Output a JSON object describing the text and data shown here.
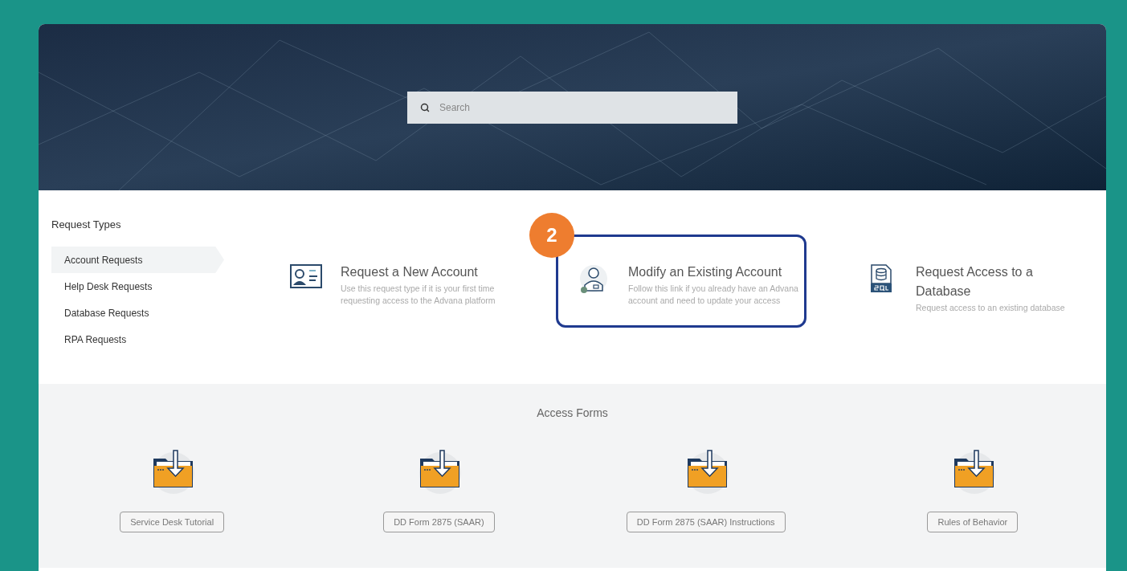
{
  "search": {
    "placeholder": "Search"
  },
  "request_types": {
    "title": "Request Types",
    "items": [
      {
        "label": "Account Requests",
        "selected": true
      },
      {
        "label": "Help Desk Requests",
        "selected": false
      },
      {
        "label": "Database Requests",
        "selected": false
      },
      {
        "label": "RPA Requests",
        "selected": false
      }
    ]
  },
  "request_cards": [
    {
      "kind": "id-card",
      "title": "Request a New Account",
      "description": "Use this request type if it is your first time requesting access to the Advana platform",
      "highlighted": false
    },
    {
      "kind": "user-gear",
      "title": "Modify an Existing Account",
      "description": "Follow this link if you already have an Advana account and need to update your access",
      "highlighted": true,
      "callout": "2"
    },
    {
      "kind": "sql",
      "title": "Request Access to a Database",
      "description": "Request access to an existing database",
      "highlighted": false
    }
  ],
  "access_forms": {
    "title": "Access Forms",
    "items": [
      {
        "label": "Service Desk Tutorial"
      },
      {
        "label": "DD Form 2875 (SAAR)"
      },
      {
        "label": "DD Form 2875 (SAAR) Instructions"
      },
      {
        "label": "Rules of Behavior"
      }
    ]
  }
}
